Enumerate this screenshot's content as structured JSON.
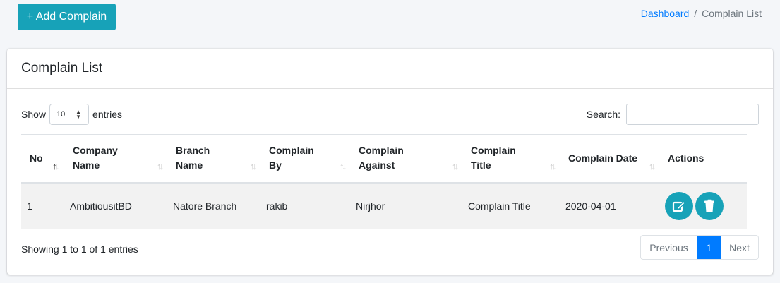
{
  "header": {
    "add_button": "+ Add Complain",
    "breadcrumb": {
      "home": "Dashboard",
      "separator": "/",
      "current": "Complain List"
    }
  },
  "card": {
    "title": "Complain List",
    "length": {
      "show_label": "Show",
      "value": "10",
      "entries_label": "entries"
    },
    "search_label": "Search:"
  },
  "table": {
    "headers": [
      [
        "No"
      ],
      [
        "Company",
        "Name"
      ],
      [
        "Branch",
        "Name"
      ],
      [
        "Complain",
        "By"
      ],
      [
        "Complain",
        "Against"
      ],
      [
        "Complain",
        "Title"
      ],
      [
        "Complain Date"
      ],
      [
        "Actions"
      ]
    ],
    "rows": [
      {
        "no": "1",
        "company": "AmbitiousitBD",
        "branch": "Natore Branch",
        "by": "rakib",
        "against": "Nirjhor",
        "title": "Complain Title",
        "date": "2020-04-01"
      }
    ]
  },
  "footer": {
    "info": "Showing 1 to 1 of 1 entries",
    "prev": "Previous",
    "page": "1",
    "next": "Next"
  },
  "colors": {
    "accent": "#17a2b8",
    "primary": "#007bff",
    "row_bg": "#f2f2f2"
  },
  "icons": {
    "edit": "edit-icon",
    "delete": "trash-icon",
    "sort": "sort-icon"
  }
}
